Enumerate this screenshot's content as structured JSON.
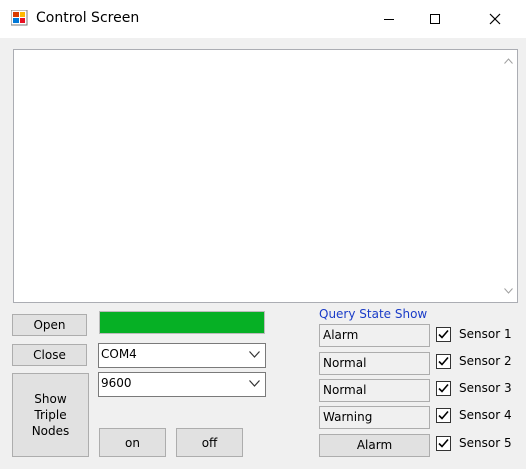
{
  "window": {
    "title": "Control Screen",
    "icon": "app-icon"
  },
  "log": {
    "text": ""
  },
  "buttons": {
    "open": "Open",
    "close": "Close",
    "show_nodes": "Show\nTriple\nNodes",
    "on": "on",
    "off": "off"
  },
  "status_color": "#06b025",
  "port": {
    "selected": "COM4"
  },
  "baud": {
    "selected": "9600"
  },
  "query": {
    "title": "Query State Show",
    "rows": [
      {
        "state": "Alarm",
        "sensor": "Sensor 1",
        "checked": true
      },
      {
        "state": "Normal",
        "sensor": "Sensor 2",
        "checked": true
      },
      {
        "state": "Normal",
        "sensor": "Sensor 3",
        "checked": true
      },
      {
        "state": "Warning",
        "sensor": "Sensor 4",
        "checked": true
      },
      {
        "state": "Alarm",
        "sensor": "Sensor 5",
        "checked": true
      }
    ]
  }
}
